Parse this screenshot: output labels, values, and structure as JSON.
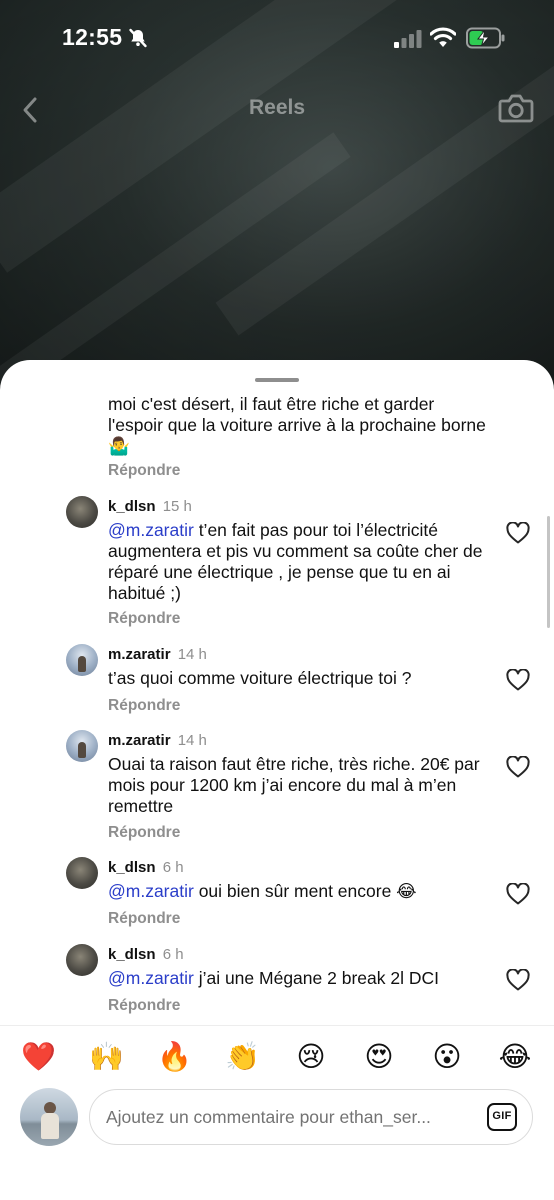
{
  "status_bar": {
    "time": "12:55"
  },
  "nav": {
    "title": "Reels"
  },
  "comments": [
    {
      "text": "moi c'est désert, il faut être riche et garder l'espoir que la voiture arrive à la prochaine borne 🤷‍♂️",
      "reply": "Répondre"
    },
    {
      "user": "k_dlsn",
      "time": "15 h",
      "mention": "@m.zaratir",
      "text": " t’en fait pas pour toi l’électricité augmentera et pis vu comment sa coûte cher de réparé une électrique , je pense que tu en ai habitué ;)",
      "reply": "Répondre"
    },
    {
      "user": "m.zaratir",
      "time": "14 h",
      "text": "t’as quoi comme voiture électrique toi ?",
      "reply": "Répondre"
    },
    {
      "user": "m.zaratir",
      "time": "14 h",
      "text": "Ouai ta raison faut être riche, très riche. 20€ par mois pour 1200 km j’ai encore du mal à m’en remettre",
      "reply": "Répondre"
    },
    {
      "user": "k_dlsn",
      "time": "6 h",
      "mention": "@m.zaratir",
      "text": " oui bien sûr ment encore 😂",
      "reply": "Répondre"
    },
    {
      "user": "k_dlsn",
      "time": "6 h",
      "mention": "@m.zaratir",
      "text": " j’ai une Mégane 2 break 2l DCI",
      "reply": "Répondre"
    }
  ],
  "reactions": [
    "❤️",
    "🙌",
    "🔥",
    "👏",
    "😢",
    "😍",
    "😮",
    "😂"
  ],
  "composer": {
    "placeholder": "Ajoutez un commentaire pour ethan_ser...",
    "gif_label": "GIF"
  },
  "colors": {
    "mention": "#2b3ec9",
    "muted": "#8e8e8e",
    "sheet": "#ffffff"
  }
}
